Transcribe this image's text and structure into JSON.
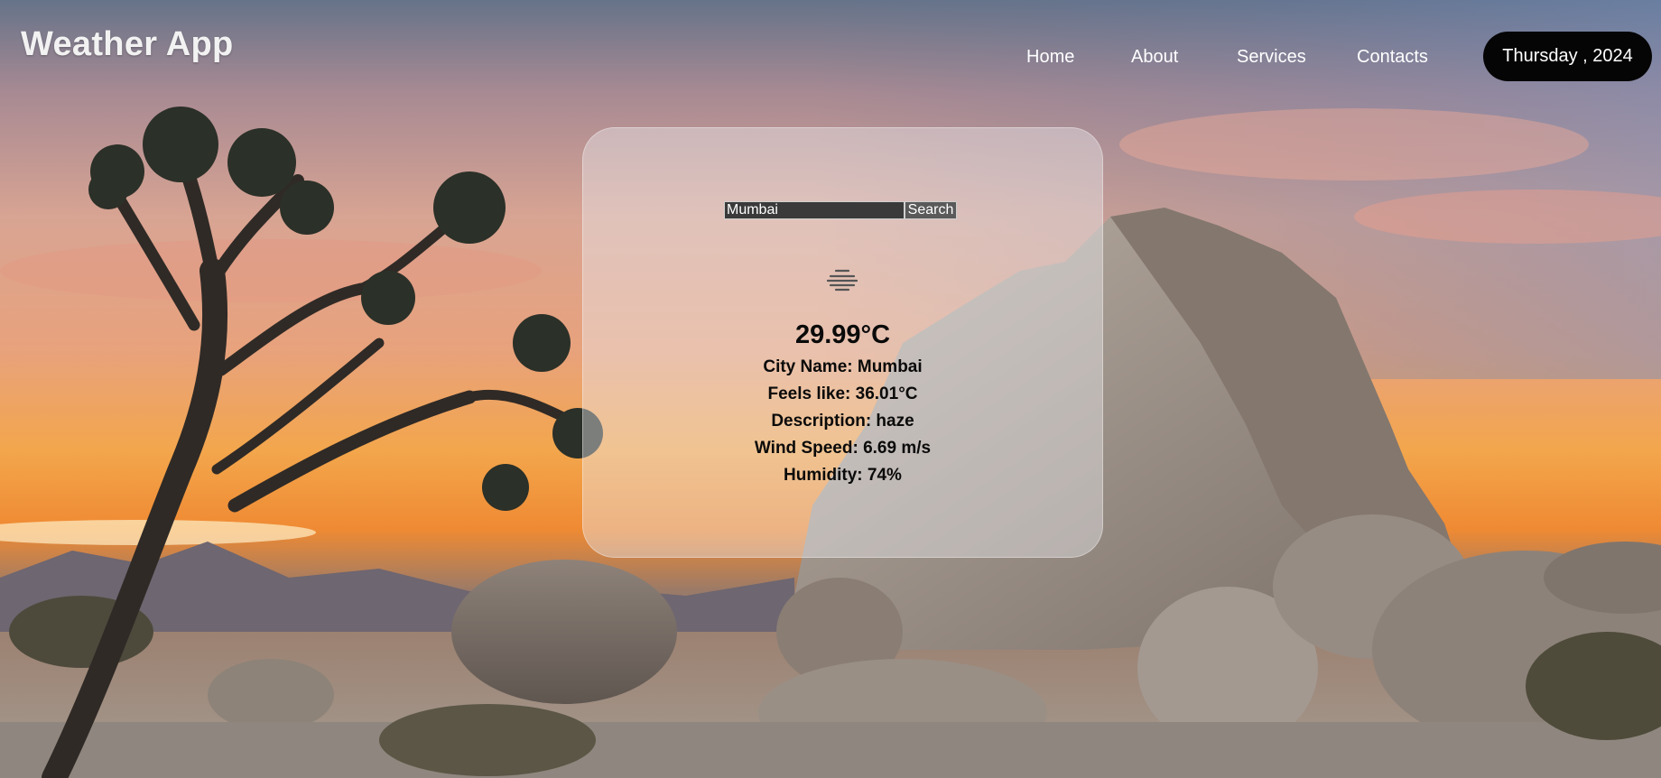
{
  "app": {
    "brand": "Weather App"
  },
  "nav": {
    "items": [
      "Home",
      "About",
      "Services",
      "Contacts"
    ]
  },
  "header": {
    "date_label": "Thursday , 2024"
  },
  "search": {
    "value": "Mumbai",
    "button_label": "Search"
  },
  "weather": {
    "icon": "haze-icon",
    "temperature": "29.99°C",
    "city_line": "City Name: Mumbai",
    "feels_like_line": "Feels like: 36.01°C",
    "description_line": "Description: haze",
    "wind_line": "Wind Speed: 6.69 m/s",
    "humidity_line": "Humidity: 74%"
  },
  "colors": {
    "date_pill_bg": "#050505",
    "card_bg": "rgba(236,236,240,0.42)",
    "brand_text": "#f2f2f2"
  }
}
